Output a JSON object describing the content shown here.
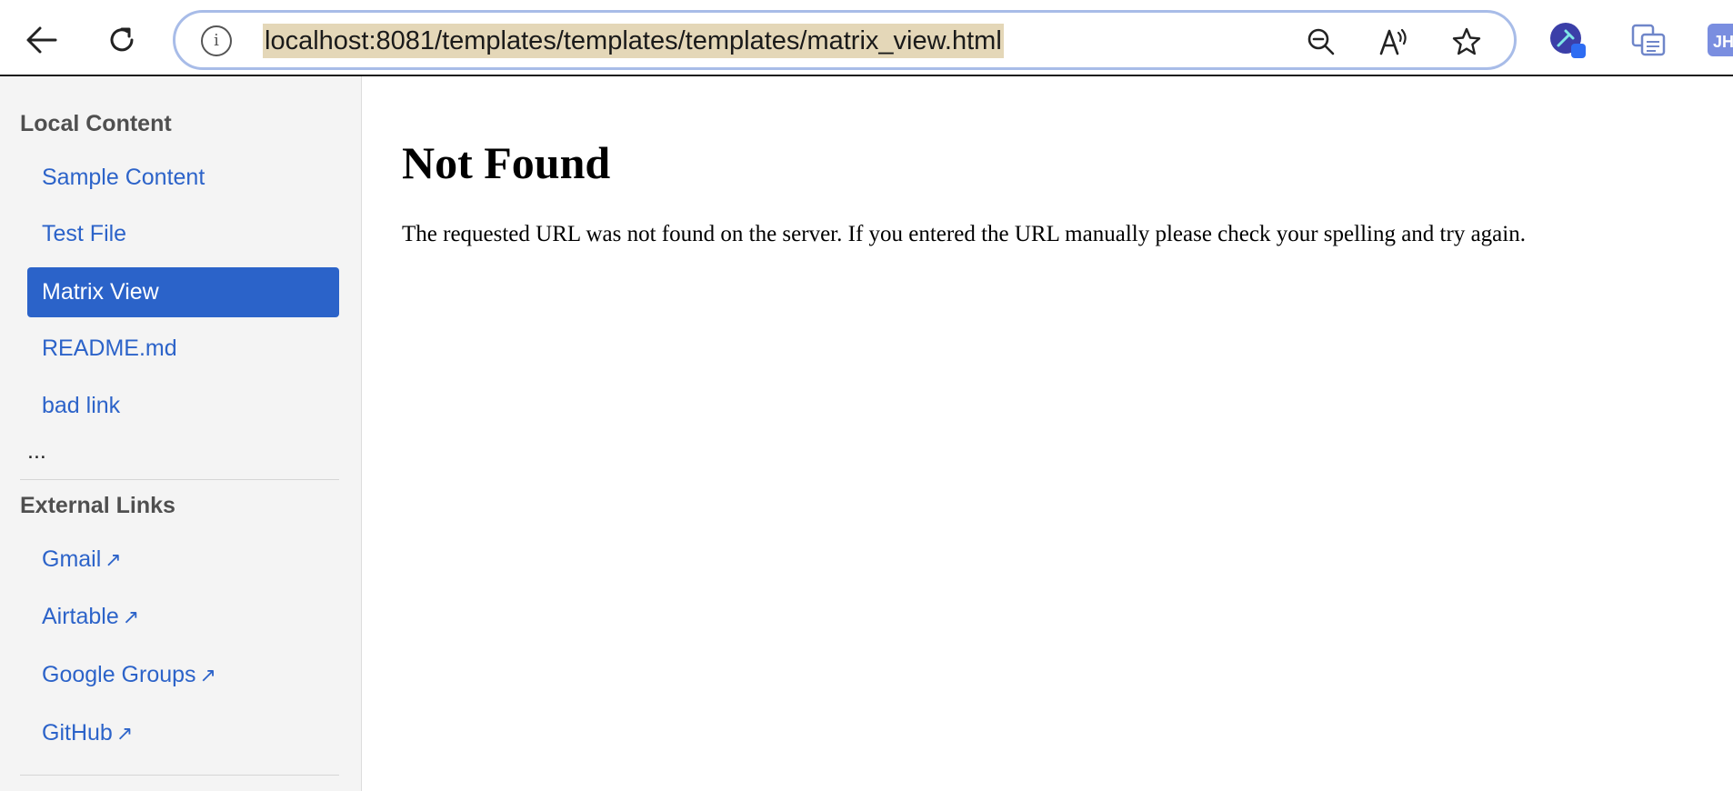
{
  "browser": {
    "url": "localhost:8081/templates/templates/templates/matrix_view.html",
    "icons": {
      "back": "back-arrow-icon",
      "reload": "reload-icon",
      "site_info": "info-icon",
      "site_info_glyph": "i",
      "zoom": "zoom-out-icon",
      "read_aloud": "read-aloud-icon",
      "favorite": "star-icon"
    },
    "extensions": [
      "extension-pin-icon",
      "extension-translate-icon",
      "extension-profile-icon"
    ],
    "extension_profile_text": "JH",
    "accent_color": "#a8bce8"
  },
  "sidebar": {
    "local_heading": "Local Content",
    "local_items": [
      {
        "label": "Sample Content",
        "active": false
      },
      {
        "label": "Test File",
        "active": false
      },
      {
        "label": "Matrix View",
        "active": true
      },
      {
        "label": "README.md",
        "active": false
      },
      {
        "label": "bad link",
        "active": false
      }
    ],
    "more_label": "...",
    "external_heading": "External Links",
    "external_items": [
      {
        "label": "Gmail",
        "arrow": "↗"
      },
      {
        "label": "Airtable",
        "arrow": "↗"
      },
      {
        "label": "Google Groups",
        "arrow": "↗"
      },
      {
        "label": "GitHub",
        "arrow": "↗"
      }
    ],
    "link_color": "#2c63c9",
    "active_color": "#2b63c9"
  },
  "main": {
    "title": "Not Found",
    "message": "The requested URL was not found on the server. If you entered the URL manually please check your spelling and try again."
  }
}
